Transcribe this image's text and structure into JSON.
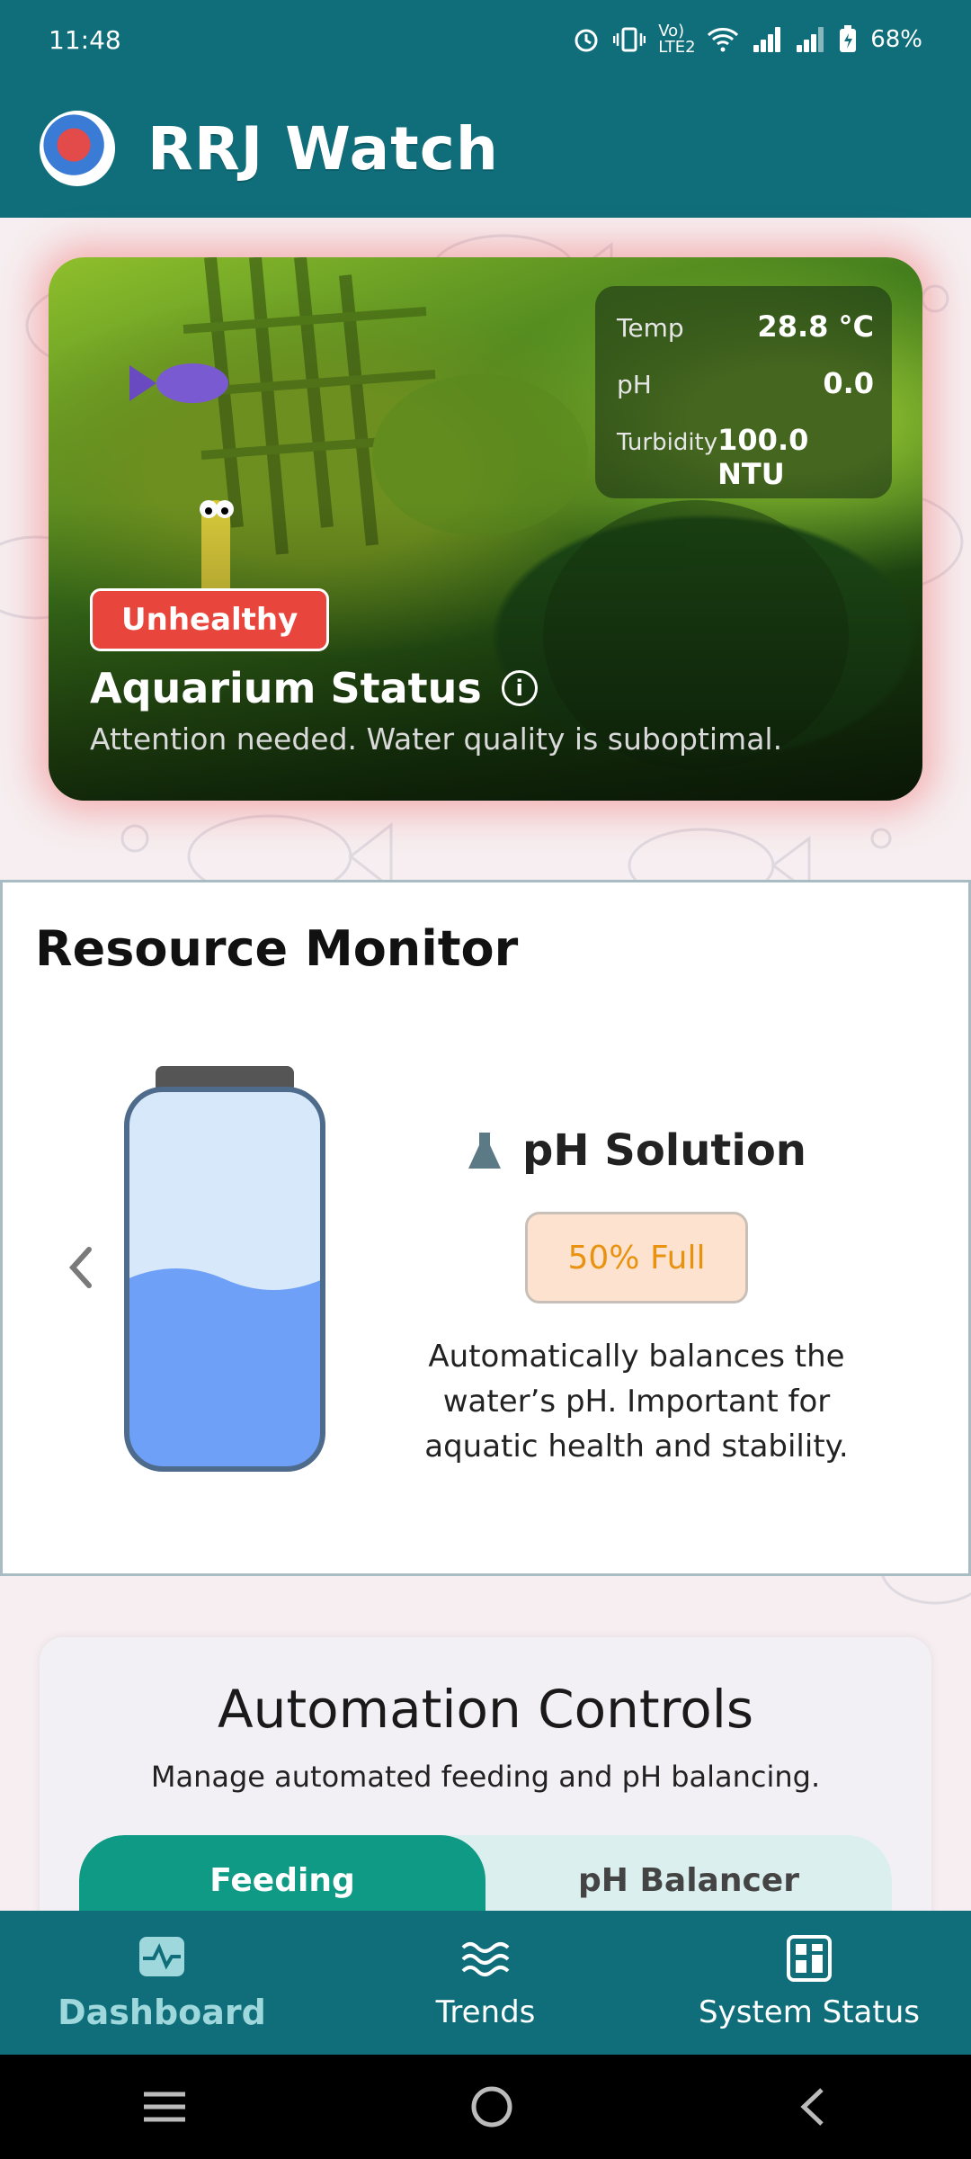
{
  "status_bar": {
    "time": "11:48",
    "network_label": "Vo) LTE2",
    "battery": "68%"
  },
  "app": {
    "title": "RRJ Watch"
  },
  "aquarium": {
    "readings": [
      {
        "label": "Temp",
        "value": "28.8 °C"
      },
      {
        "label": "pH",
        "value": "0.0"
      },
      {
        "label": "Turbidity",
        "value": "100.0 NTU"
      }
    ],
    "badge": "Unhealthy",
    "title": "Aquarium Status",
    "subtitle": "Attention needed. Water quality is suboptimal.",
    "badge_color": "#e8453c"
  },
  "resource_monitor": {
    "title": "Resource Monitor",
    "resource_name": "pH Solution",
    "level_label": "50% Full",
    "level_fraction": 0.5,
    "description": "Automatically balances the water’s pH. Important for aquatic health and stability.",
    "liquid_color": "#6ea0f7"
  },
  "automation": {
    "title": "Automation Controls",
    "subtitle": "Manage automated feeding and pH balancing.",
    "tabs": [
      {
        "label": "Feeding",
        "active": true
      },
      {
        "label": "pH Balancer",
        "active": false
      }
    ]
  },
  "bottom_nav": {
    "items": [
      {
        "label": "Dashboard",
        "icon": "activity-icon",
        "active": true
      },
      {
        "label": "Trends",
        "icon": "waves-icon",
        "active": false
      },
      {
        "label": "System Status",
        "icon": "grid-icon",
        "active": false
      }
    ]
  },
  "colors": {
    "primary": "#0f6e7a",
    "accent": "#0e9a84"
  }
}
